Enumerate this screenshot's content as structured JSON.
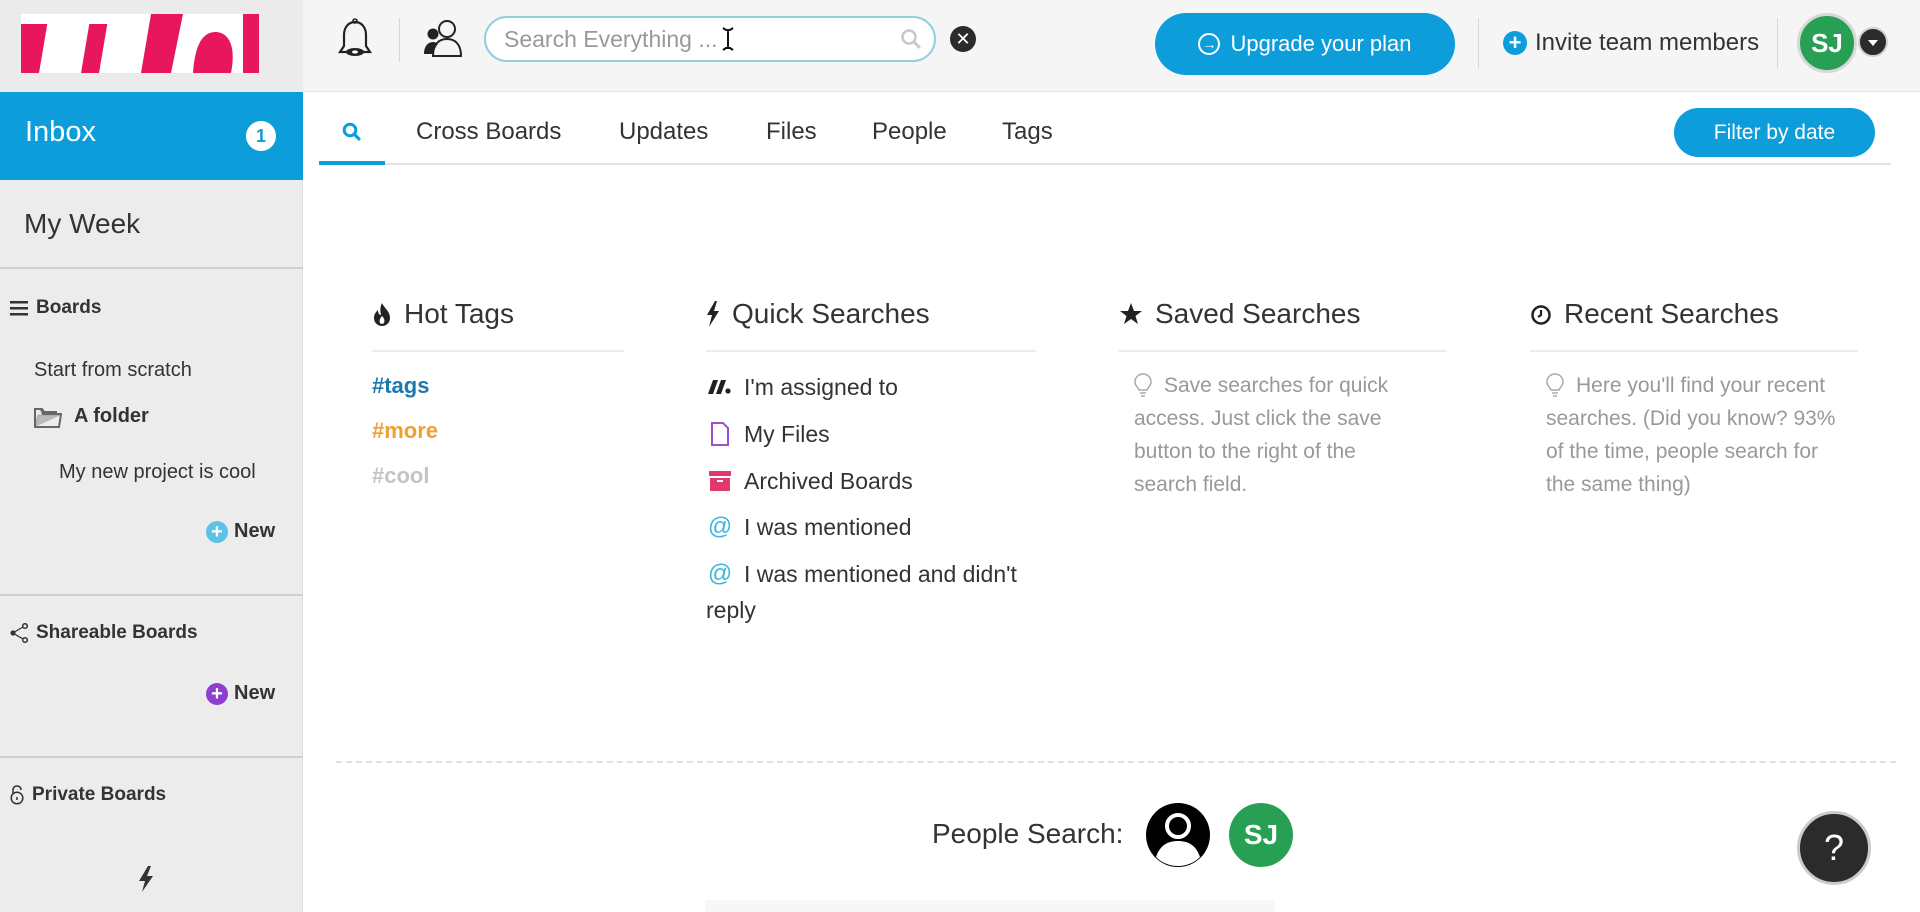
{
  "topbar": {
    "search": {
      "placeholder": "Search Everything ...",
      "value": ""
    },
    "clear_label": "✕",
    "upgrade_label": "Upgrade your plan",
    "invite_label": "Invite team members",
    "user_initials": "SJ"
  },
  "sidebar": {
    "inbox": {
      "label": "Inbox",
      "badge": "1"
    },
    "my_week": "My Week",
    "boards": {
      "header": "Boards",
      "items": [
        {
          "label": "Start from scratch"
        },
        {
          "label": "A folder",
          "type": "folder"
        },
        {
          "label": "My new project is cool",
          "type": "board"
        }
      ],
      "new_label": "New"
    },
    "shareable": {
      "header": "Shareable Boards",
      "new_label": "New"
    },
    "private": {
      "header": "Private Boards"
    }
  },
  "tabs": {
    "items": [
      {
        "label": "Cross Boards"
      },
      {
        "label": "Updates"
      },
      {
        "label": "Files"
      },
      {
        "label": "People"
      },
      {
        "label": "Tags"
      }
    ],
    "active": "search",
    "filter_label": "Filter by date"
  },
  "hot_tags": {
    "title": "Hot Tags",
    "tags": [
      {
        "label": "#tags",
        "color": "#1a7ab0"
      },
      {
        "label": "#more",
        "color": "#f0a030"
      },
      {
        "label": "#cool",
        "color": "#c4c4c4"
      }
    ]
  },
  "quick_searches": {
    "title": "Quick Searches",
    "items": [
      {
        "label": "I'm assigned to",
        "icon": "assigned-icon"
      },
      {
        "label": "My Files",
        "icon": "file-icon"
      },
      {
        "label": "Archived Boards",
        "icon": "archive-icon"
      },
      {
        "label": "I was mentioned",
        "icon": "at-icon"
      },
      {
        "label": "I was mentioned and didn't reply",
        "icon": "at-icon"
      }
    ]
  },
  "saved_searches": {
    "title": "Saved Searches",
    "hint": "Save searches for quick access. Just click the save button to the right of the search field."
  },
  "recent_searches": {
    "title": "Recent Searches",
    "hint": "Here you'll find your recent searches. (Did you know? 93% of the time, people search for the same thing)"
  },
  "people_search": {
    "label": "People Search:",
    "people": [
      {
        "type": "anonymous"
      },
      {
        "initials": "SJ",
        "color": "#28a054"
      }
    ]
  },
  "help_label": "?",
  "colors": {
    "accent": "#0d9ddb",
    "brand": "#e8175d",
    "user_green": "#28a054"
  }
}
